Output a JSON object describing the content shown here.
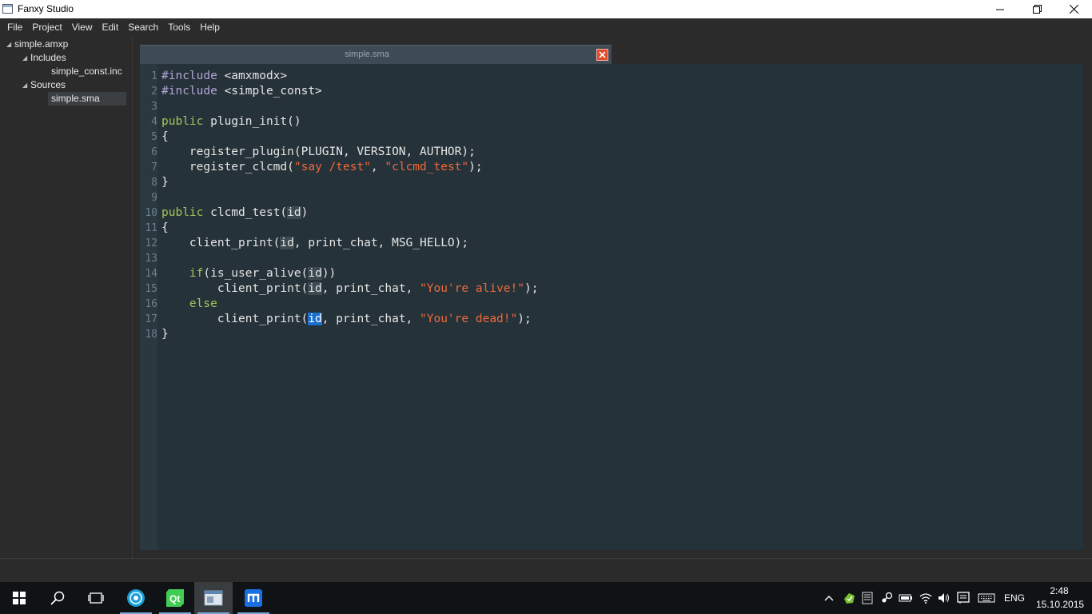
{
  "window": {
    "title": "Fanxy Studio"
  },
  "menu": {
    "items": [
      "File",
      "Project",
      "View",
      "Edit",
      "Search",
      "Tools",
      "Help"
    ]
  },
  "project_tree": {
    "project": "simple.amxp",
    "includes_label": "Includes",
    "include_file": "simple_const.inc",
    "sources_label": "Sources",
    "source_file": "simple.sma"
  },
  "editor": {
    "tab_title": "simple.sma",
    "line_numbers": [
      "1",
      "2",
      "3",
      "4",
      "5",
      "6",
      "7",
      "8",
      "9",
      "10",
      "11",
      "12",
      "13",
      "14",
      "15",
      "16",
      "17",
      "18"
    ],
    "code": {
      "l1_pp": "#include",
      "l1_rest": " <amxmodx>",
      "l2_pp": "#include",
      "l2_rest": " <simple_const>",
      "l4_kw": "public",
      "l4_rest": " plugin_init()",
      "brace_open": "{",
      "brace_close": "}",
      "l6": "    register_plugin(PLUGIN, VERSION, AUTHOR);",
      "l7_a": "    register_clcmd(",
      "l7_s1": "\"say /test\"",
      "l7_b": ", ",
      "l7_s2": "\"clcmd_test\"",
      "l7_c": ");",
      "l10_kw": "public",
      "l10_a": " clcmd_test(",
      "id": "id",
      "l10_b": ")",
      "l12_a": "    client_print(",
      "l12_b": ", print_chat, MSG_HELLO);",
      "l14_indent": "    ",
      "l14_kw": "if",
      "l14_a": "(is_user_alive(",
      "l14_b": "))",
      "l15_a": "        client_print(",
      "l15_b": ", print_chat, ",
      "l15_s": "\"You're alive!\"",
      "l15_c": ");",
      "l16_indent": "    ",
      "l16_kw": "else",
      "l17_a": "        client_print(",
      "l17_b": ", print_chat, ",
      "l17_s": "\"You're dead!\"",
      "l17_c": ");"
    }
  },
  "taskbar": {
    "language": "ENG",
    "time": "2:48",
    "date": "15.10.2015"
  },
  "colors": {
    "background": "#2b2b2b",
    "editor_bg": "#263239",
    "keyword": "#a1c659",
    "preprocessor": "#b3a4d6",
    "string": "#ef6a3a",
    "selection": "#1a6fcf",
    "tab_close": "#e04a2a"
  },
  "icons": {
    "tab_close": "close-icon",
    "taskbar": [
      "windows-start-icon",
      "search-icon",
      "task-view-icon",
      "fanxy-studio-icon",
      "qt-creator-icon",
      "editor-window-icon",
      "maxthon-icon"
    ],
    "tray": [
      "chevron-up-icon",
      "green-app-icon",
      "network-drive-icon",
      "steam-icon",
      "battery-icon",
      "wifi-icon",
      "volume-icon",
      "action-center-icon",
      "keyboard-icon"
    ]
  }
}
